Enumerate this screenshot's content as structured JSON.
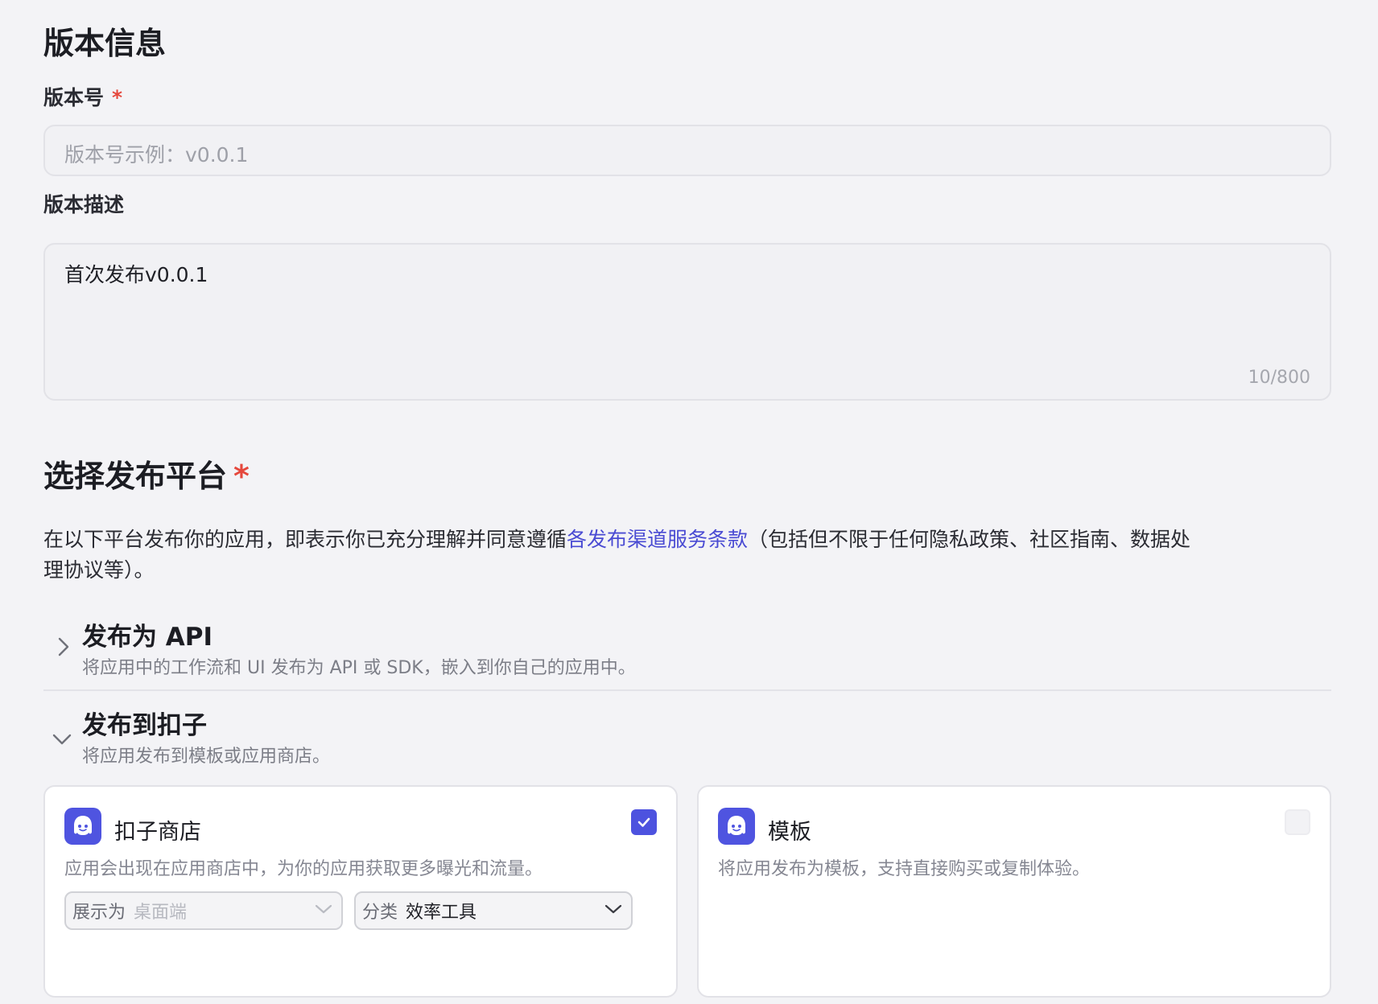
{
  "version_info": {
    "heading": "版本信息",
    "version_label": "版本号",
    "required_mark": "*",
    "version_placeholder": "版本号示例：v0.0.1",
    "desc_label": "版本描述",
    "desc_value": "首次发布v0.0.1",
    "desc_counter": "10/800"
  },
  "platform": {
    "heading": "选择发布平台",
    "required_mark": "*",
    "notice_before": "在以下平台发布你的应用，即表示你已充分理解并同意遵循",
    "notice_link": "各发布渠道服务条款",
    "notice_after_line1": "（包括但不限于任何隐私政策、社区指南、数据处",
    "notice_line2": "理协议等）。"
  },
  "sections": [
    {
      "title": "发布为 API",
      "subtitle": "将应用中的工作流和 UI 发布为 API 或 SDK，嵌入到你自己的应用中。",
      "expanded": false
    },
    {
      "title": "发布到扣子",
      "subtitle": "将应用发布到模板或应用商店。",
      "expanded": true
    }
  ],
  "cards": [
    {
      "icon": "coze-bot-icon",
      "title": "扣子商店",
      "description": "应用会出现在应用商店中，为你的应用获取更多曝光和流量。",
      "checked": true,
      "display_select": {
        "label": "展示为",
        "value": "桌面端"
      },
      "category_select": {
        "label": "分类",
        "value": "效率工具"
      }
    },
    {
      "icon": "coze-bot-icon",
      "title": "模板",
      "description": "将应用发布为模板，支持直接购买或复制体验。",
      "checked": false
    }
  ],
  "colors": {
    "accent": "#4d52df",
    "link": "#4a4bd3",
    "required": "#e5483d",
    "background": "#f3f3f6"
  }
}
